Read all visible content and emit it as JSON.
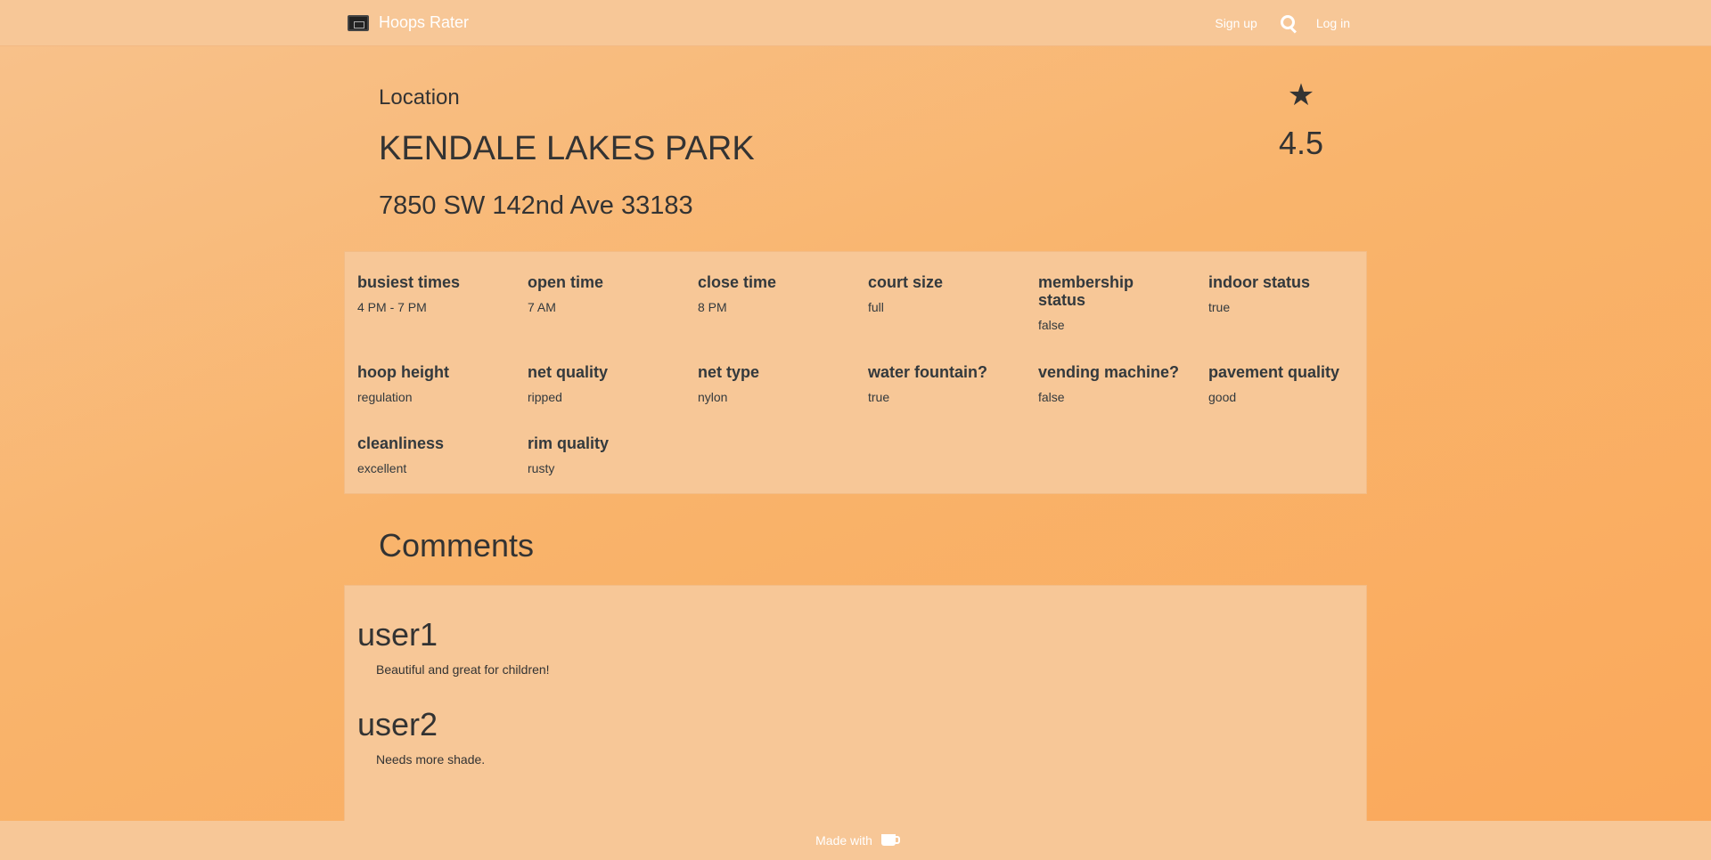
{
  "navbar": {
    "brand": "Hoops Rater",
    "signup": "Sign up",
    "login": "Log in",
    "search_icon": "search-icon",
    "brand_icon": "court-logo-icon"
  },
  "header": {
    "label": "Location",
    "name": "KENDALE LAKES PARK",
    "address": "7850 SW 142nd Ave 33183",
    "rating": "4.5",
    "rating_icon": "star-icon"
  },
  "attributes": [
    {
      "label": "busiest times",
      "value": "4 PM - 7 PM"
    },
    {
      "label": "open time",
      "value": "7 AM"
    },
    {
      "label": "close time",
      "value": "8 PM"
    },
    {
      "label": "court size",
      "value": "full"
    },
    {
      "label": "membership status",
      "value": "false"
    },
    {
      "label": "indoor status",
      "value": "true"
    },
    {
      "label": "hoop height",
      "value": "regulation"
    },
    {
      "label": "net quality",
      "value": "ripped"
    },
    {
      "label": "net type",
      "value": "nylon"
    },
    {
      "label": "water fountain?",
      "value": "true"
    },
    {
      "label": "vending machine?",
      "value": "false"
    },
    {
      "label": "pavement quality",
      "value": "good"
    },
    {
      "label": "cleanliness",
      "value": "excellent"
    },
    {
      "label": "rim quality",
      "value": "rusty"
    }
  ],
  "comments": {
    "title": "Comments",
    "items": [
      {
        "user": "user1",
        "text": "Beautiful and great for children!"
      },
      {
        "user": "user2",
        "text": "Needs more shade."
      }
    ]
  },
  "footer": {
    "text": "Made with",
    "icon": "coffee-icon"
  },
  "colors": {
    "background": "#f9b46c",
    "panel": "#f7c797",
    "text": "#333333"
  }
}
